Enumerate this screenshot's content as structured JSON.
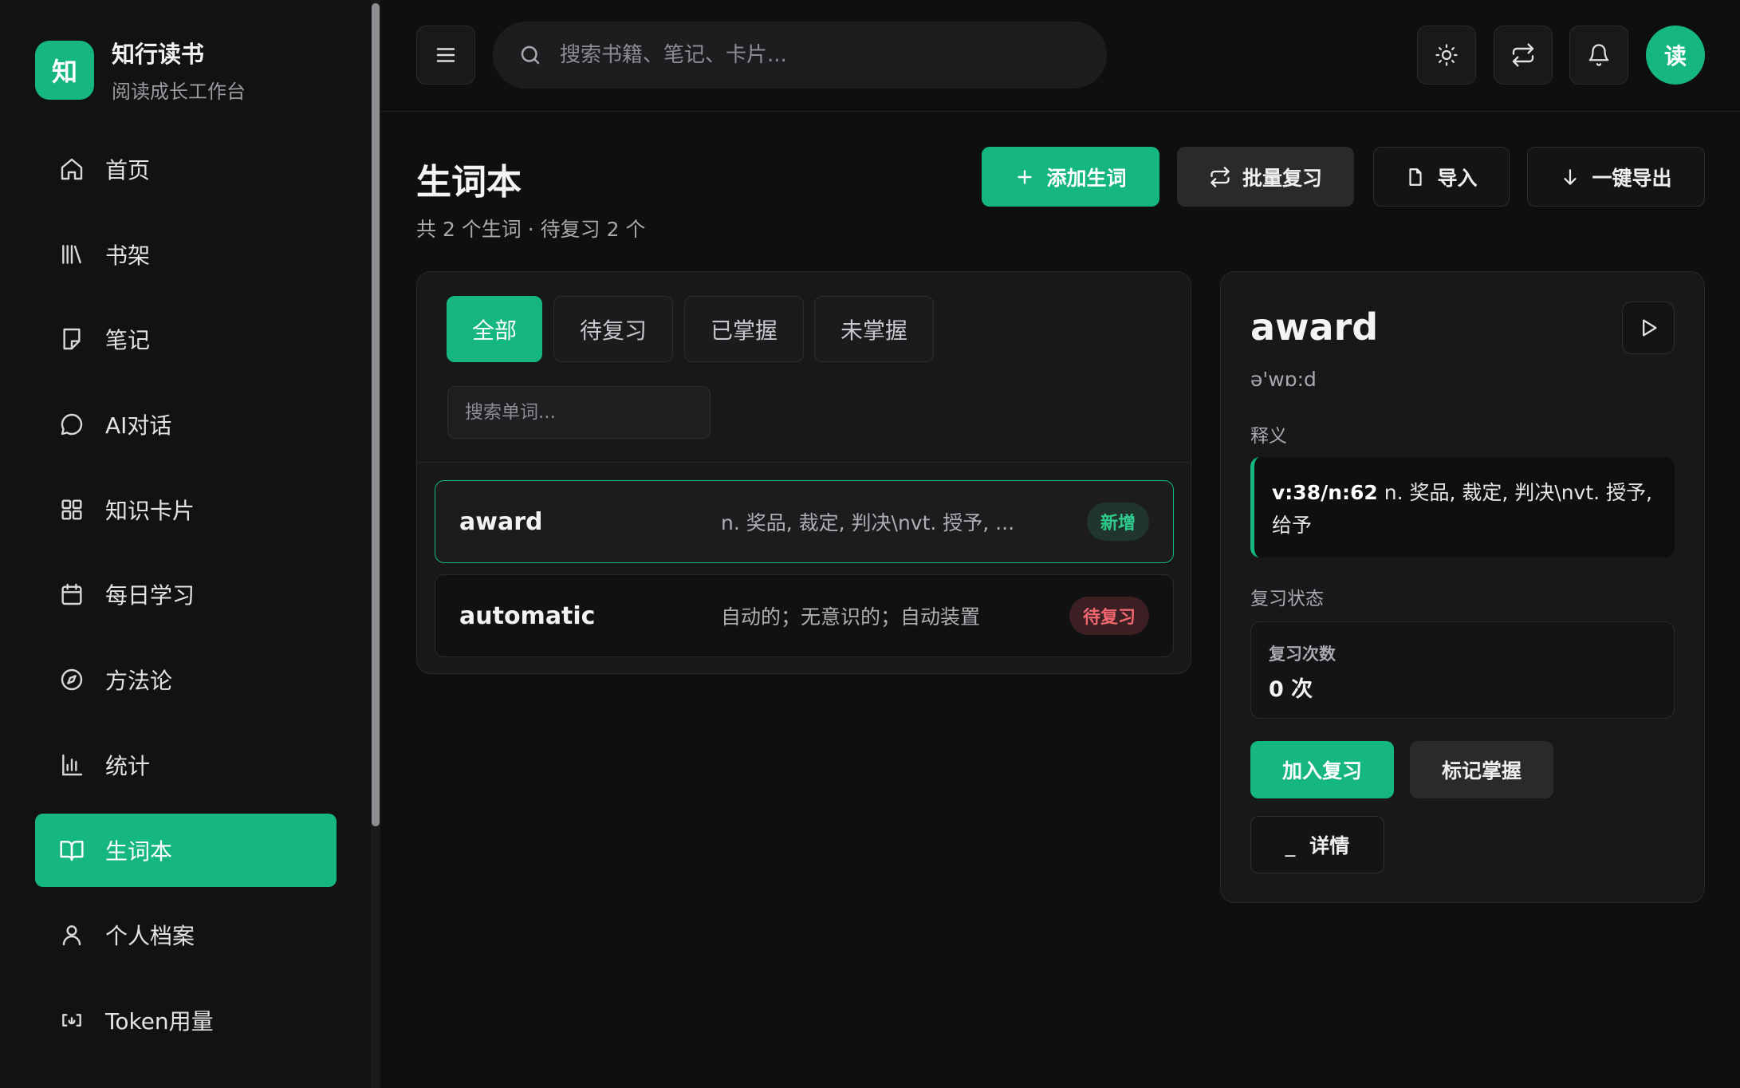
{
  "brand": {
    "logo_char": "知",
    "name": "知行读书",
    "subtitle": "阅读成长工作台"
  },
  "sidebar": {
    "items": [
      {
        "label": "首页",
        "icon": "home-icon",
        "active": false
      },
      {
        "label": "书架",
        "icon": "library-icon",
        "active": false
      },
      {
        "label": "笔记",
        "icon": "note-icon",
        "active": false
      },
      {
        "label": "AI对话",
        "icon": "chat-icon",
        "active": false
      },
      {
        "label": "知识卡片",
        "icon": "grid-icon",
        "active": false
      },
      {
        "label": "每日学习",
        "icon": "calendar-icon",
        "active": false
      },
      {
        "label": "方法论",
        "icon": "compass-icon",
        "active": false
      },
      {
        "label": "统计",
        "icon": "bar-chart-icon",
        "active": false
      },
      {
        "label": "生词本",
        "icon": "book-open-icon",
        "active": true
      },
      {
        "label": "个人档案",
        "icon": "user-icon",
        "active": false
      },
      {
        "label": "Token用量",
        "icon": "token-icon",
        "active": false
      }
    ]
  },
  "topbar": {
    "search_placeholder": "搜索书籍、笔记、卡片...",
    "avatar_char": "读"
  },
  "page": {
    "title": "生词本",
    "subtitle": "共 2 个生词 · 待复习 2 个",
    "actions": {
      "add": "添加生词",
      "batch_review": "批量复习",
      "import": "导入",
      "export": "一键导出"
    }
  },
  "word_list": {
    "tabs": [
      "全部",
      "待复习",
      "已掌握",
      "未掌握"
    ],
    "active_tab": "全部",
    "search_placeholder": "搜索单词...",
    "rows": [
      {
        "word": "award",
        "definition": "n. 奖品, 裁定, 判决\\nvt. 授予, ...",
        "badge": "新增",
        "badge_type": "new",
        "selected": true
      },
      {
        "word": "automatic",
        "definition": "自动的；无意识的；自动装置",
        "badge": "待复习",
        "badge_type": "review",
        "selected": false
      }
    ]
  },
  "detail": {
    "word": "award",
    "phonetic": "ə'wɒ:d",
    "meaning_label": "释义",
    "meaning_prefix": "v:38/n:62",
    "meaning_text": " n. 奖品, 裁定, 判决\\nvt. 授予, 给予",
    "status_label": "复习状态",
    "review_count_label": "复习次数",
    "review_count_value": "0 次",
    "add_review_button": "加入复习",
    "mark_mastered_button": "标记掌握",
    "details_button": "详情",
    "details_prefix": "_"
  },
  "colors": {
    "accent": "#15b77e",
    "new_badge": "#2fcc8d",
    "review_badge": "#f0676f"
  }
}
